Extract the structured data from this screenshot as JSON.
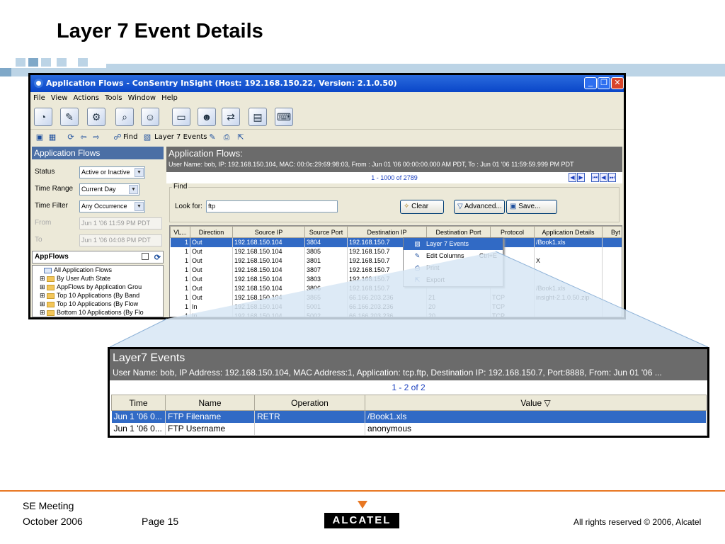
{
  "slide": {
    "title": "Layer 7 Event Details",
    "footer_meeting": "SE Meeting",
    "footer_date": "October 2006",
    "footer_page": "Page 15",
    "footer_rights": "All rights reserved © 2006, Alcatel",
    "logo": "ALCATEL"
  },
  "window": {
    "title": "Application Flows - ConSentry InSight (Host: 192.168.150.22, Version: 2.1.0.50)",
    "menu": [
      "File",
      "View",
      "Actions",
      "Tools",
      "Window",
      "Help"
    ],
    "toolbar_find": "Find",
    "toolbar_layer7": "Layer 7 Events"
  },
  "left_panel": {
    "header": "Application Flows",
    "filters": [
      {
        "label": "Status",
        "value": "Active or Inactive"
      },
      {
        "label": "Time Range",
        "value": "Current Day"
      },
      {
        "label": "Time Filter",
        "value": "Any Occurrence"
      },
      {
        "label": "From",
        "value": "Jun 1 '06 11:59 PM PDT"
      },
      {
        "label": "To",
        "value": "Jun 1 '06 04:08 PM PDT"
      }
    ],
    "appflows_header": "AppFlows",
    "tree": [
      "All Application Flows",
      "By User Auth State",
      "AppFlows by Application Grou",
      "Top 10 Applications (By Band",
      "Top 10 Applications (By Flow",
      "Bottom 10 Applications (By Flo"
    ]
  },
  "right_panel": {
    "header": "Application Flows:",
    "subheader": "User Name: bob, IP: 192.168.150.104, MAC: 00:0c:29:69:98:03, From : Jun 01 '06 00:00:00.000 AM PDT, To : Jun 01 '06 11:59:59.999 PM PDT",
    "pager": "1 - 1000 of 2789",
    "find_legend": "Find",
    "look_for_label": "Look for:",
    "look_for_value": "ftp",
    "btn_clear": "Clear",
    "btn_advanced": "Advanced...",
    "btn_save": "Save...",
    "columns": [
      "VL...",
      "Direction",
      "Source IP",
      "Source Port",
      "Destination IP",
      "Destination Port",
      "Protocol",
      "Application Details",
      "Byt"
    ],
    "rows": [
      [
        "1",
        "Out",
        "192.168.150.104",
        "3804",
        "192.168.150.7",
        "",
        "",
        "/Book1.xls",
        ""
      ],
      [
        "1",
        "Out",
        "192.168.150.104",
        "3805",
        "192.168.150.7",
        "",
        "",
        "",
        ""
      ],
      [
        "1",
        "Out",
        "192.168.150.104",
        "3801",
        "192.168.150.7",
        "",
        "",
        "X",
        ""
      ],
      [
        "1",
        "Out",
        "192.168.150.104",
        "3807",
        "192.168.150.7",
        "",
        "",
        "",
        ""
      ],
      [
        "1",
        "Out",
        "192.168.150.104",
        "3803",
        "192.168.150.7",
        "",
        "",
        "",
        ""
      ],
      [
        "1",
        "Out",
        "192.168.150.104",
        "3806",
        "192.168.150.7",
        "",
        "",
        "/Book1.xls",
        ""
      ],
      [
        "1",
        "Out",
        "192.168.150.104",
        "3865",
        "66.166.203.236",
        "21",
        "TCP",
        "insight-2.1.0.50.zip",
        ""
      ],
      [
        "1",
        "In",
        "192.168.150.104",
        "5001",
        "66.166.203.236",
        "20",
        "TCP",
        "",
        ""
      ],
      [
        "1",
        "In",
        "192.168.150.104",
        "5002",
        "66.166.203.236",
        "20",
        "TCP",
        "",
        ""
      ]
    ]
  },
  "context_menu": {
    "items": [
      {
        "label": "Layer 7 Events",
        "shortcut": ""
      },
      {
        "label": "Edit Columns",
        "shortcut": "Ctrl+E"
      },
      {
        "label": "Print",
        "shortcut": ""
      },
      {
        "label": "Export",
        "shortcut": ""
      }
    ]
  },
  "layer7": {
    "title": "Layer7 Events",
    "subtitle": "User Name: bob, IP Address: 192.168.150.104, MAC Address:1, Application: tcp.ftp, Destination IP: 192.168.150.7, Port:8888, From: Jun 01 '06 ...",
    "pager": "1 - 2 of 2",
    "columns": [
      "Time",
      "Name",
      "Operation",
      "Value ▽"
    ],
    "rows": [
      [
        "Jun 1 '06 0...",
        "FTP Filename",
        "RETR",
        "/Book1.xls"
      ],
      [
        "Jun 1 '06 0...",
        "FTP Username",
        "",
        "anonymous"
      ]
    ]
  },
  "colors": {
    "accent": "#e87722",
    "selection": "#316ac5",
    "header_gray": "#6b6b6b",
    "titlebar": "#0a46c8"
  }
}
